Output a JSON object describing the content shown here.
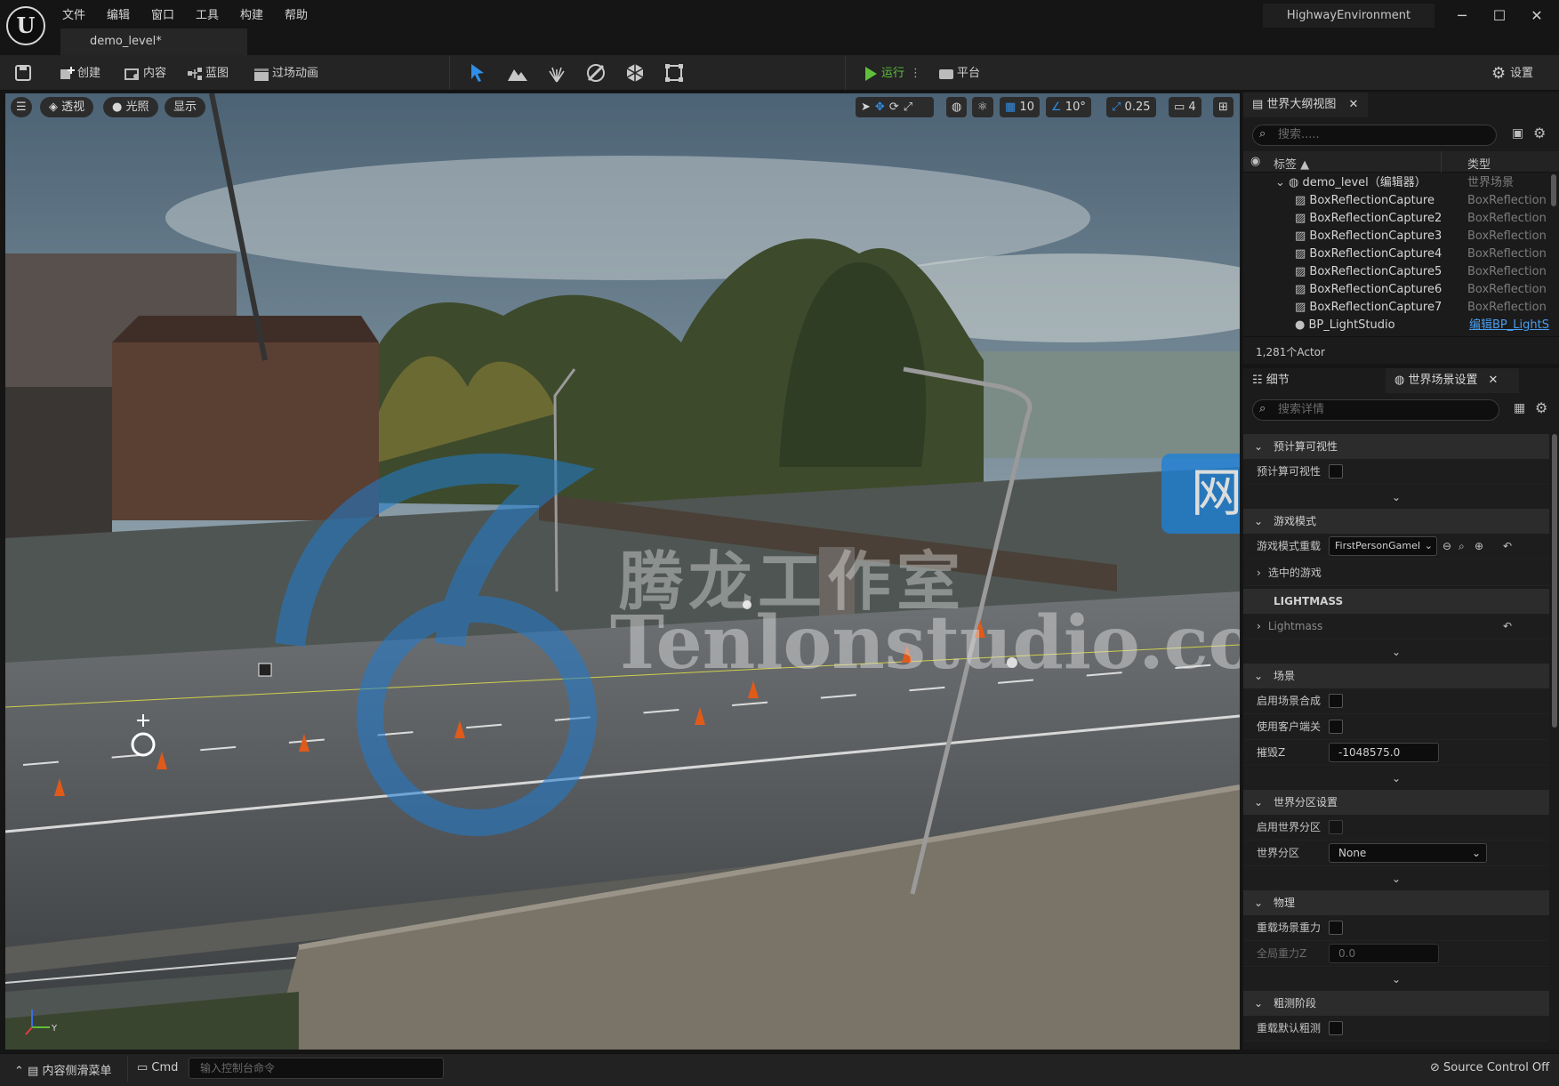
{
  "menu": [
    "文件",
    "编辑",
    "窗口",
    "工具",
    "构建",
    "帮助"
  ],
  "tab": {
    "label": "demo_level*"
  },
  "project": "HighwayEnvironment",
  "toolbar": {
    "create": "创建",
    "content": "内容",
    "blueprint": "蓝图",
    "cinematics": "过场动画",
    "play": "运行",
    "platform": "平台",
    "settings": "设置"
  },
  "viewport": {
    "perspective": "透视",
    "lighting": "光照",
    "show": "显示",
    "grid_snap": "10",
    "rotate_snap": "10°",
    "scale_snap": "0.25",
    "camera_speed": "4"
  },
  "watermark": {
    "cn": "腾龙工作室",
    "site": "网站",
    "en": "Tenlonstudio.com"
  },
  "outliner": {
    "title": "世界大纲视图",
    "search_placeholder": "搜索.....",
    "col_label": "标签",
    "col_type": "类型",
    "rows": [
      {
        "name": "demo_level（编辑器）",
        "type": "世界场景"
      },
      {
        "name": "BoxReflectionCapture",
        "type": "BoxReflection"
      },
      {
        "name": "BoxReflectionCapture2",
        "type": "BoxReflection"
      },
      {
        "name": "BoxReflectionCapture3",
        "type": "BoxReflection"
      },
      {
        "name": "BoxReflectionCapture4",
        "type": "BoxReflection"
      },
      {
        "name": "BoxReflectionCapture5",
        "type": "BoxReflection"
      },
      {
        "name": "BoxReflectionCapture6",
        "type": "BoxReflection"
      },
      {
        "name": "BoxReflectionCapture7",
        "type": "BoxReflection"
      },
      {
        "name": "BP_LightStudio",
        "type": "编辑BP_LightS"
      }
    ],
    "count": "1,281个Actor"
  },
  "details": {
    "tab1": "细节",
    "tab2": "世界场景设置",
    "search_placeholder": "搜索详情",
    "s_precomputed": "预计算可视性",
    "p_precomputed": "预计算可视性",
    "s_gamemode": "游戏模式",
    "p_gamemode_override": "游戏模式重载",
    "gamemode_value": "FirstPersonGameI",
    "p_selected": "选中的游戏",
    "s_lightmass": "LIGHTMASS",
    "p_lightmass": "Lightmass",
    "s_scene": "场景",
    "p_world_comp": "启用场景合成",
    "p_client_nav": "使用客户端关",
    "p_killz": "摧毁Z",
    "killz_value": "-1048575.0",
    "s_partition": "世界分区设置",
    "p_enable_partition": "启用世界分区",
    "p_partition": "世界分区",
    "partition_value": "None",
    "s_physics": "物理",
    "p_override_gravity": "重载场景重力",
    "p_global_gravity": "全局重力Z",
    "gravity_value": "0.0",
    "s_broadphase": "粗测阶段",
    "p_override_broadphase": "重载默认粗测"
  },
  "status": {
    "drawer": "内容侧滑菜单",
    "cmd": "Cmd",
    "console_placeholder": "输入控制台命令",
    "source_control": "Source Control Off"
  }
}
